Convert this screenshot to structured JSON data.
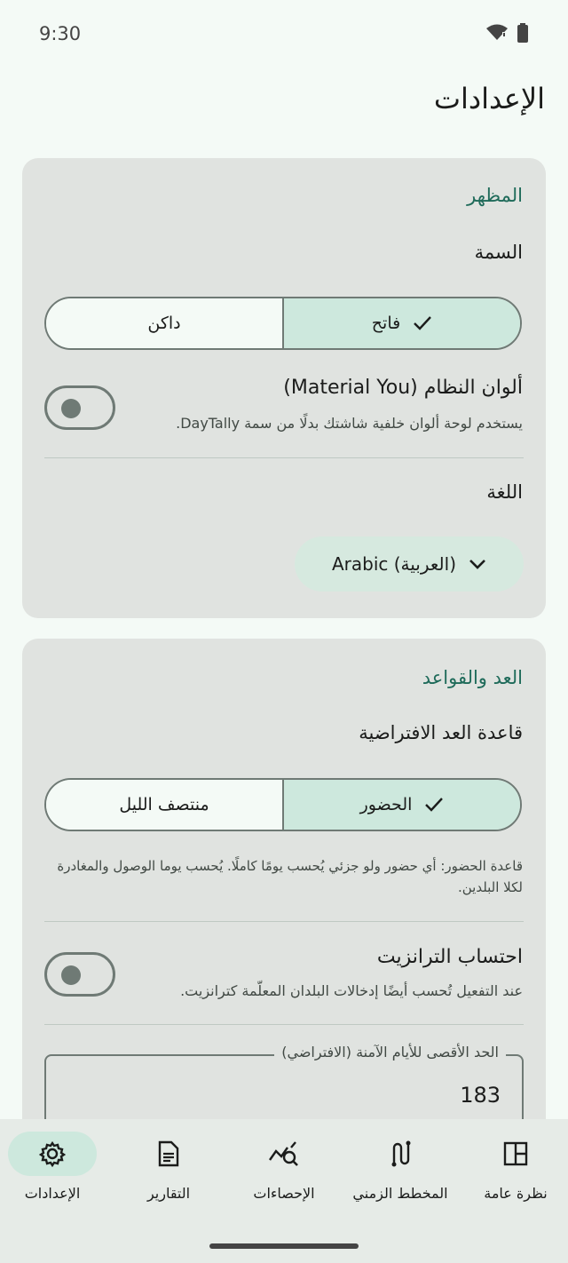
{
  "status": {
    "time": "9:30"
  },
  "page_title": "الإعدادات",
  "appearance": {
    "section_title": "المظهر",
    "theme_label": "السمة",
    "theme_options": {
      "light": "فاتح",
      "dark": "داكن"
    },
    "system_colors_title": "ألوان النظام (Material You)",
    "system_colors_subtitle": "يستخدم لوحة ألوان خلفية شاشتك بدلًا من سمة DayTally.",
    "language_label": "اللغة",
    "language_value": "Arabic (العربية)"
  },
  "counting": {
    "section_title": "العد والقواعد",
    "default_rule_label": "قاعدة العد الافتراضية",
    "rule_options": {
      "presence": "الحضور",
      "midnight": "منتصف الليل"
    },
    "rule_note": "قاعدة الحضور: أي حضور ولو جزئي يُحسب يومًا كاملًا. يُحسب يوما الوصول والمغادرة لكلا البلدين.",
    "transit_title": "احتساب الترانزيت",
    "transit_subtitle": "عند التفعيل تُحسب أيضًا إدخالات البلدان المعلّمة كترانزيت.",
    "max_safe_days_label": "الحد الأقصى للأيام الآمنة (الافتراضي)",
    "max_safe_days_value": "183"
  },
  "nav": {
    "overview": "نظرة عامة",
    "timeline": "المخطط الزمني",
    "stats": "الإحصاءات",
    "reports": "التقارير",
    "settings": "الإعدادات"
  },
  "colors": {
    "accent": "#1f6b5a",
    "selected": "#cde8dd",
    "card": "#e0e3e0",
    "background": "#f4faf6"
  }
}
